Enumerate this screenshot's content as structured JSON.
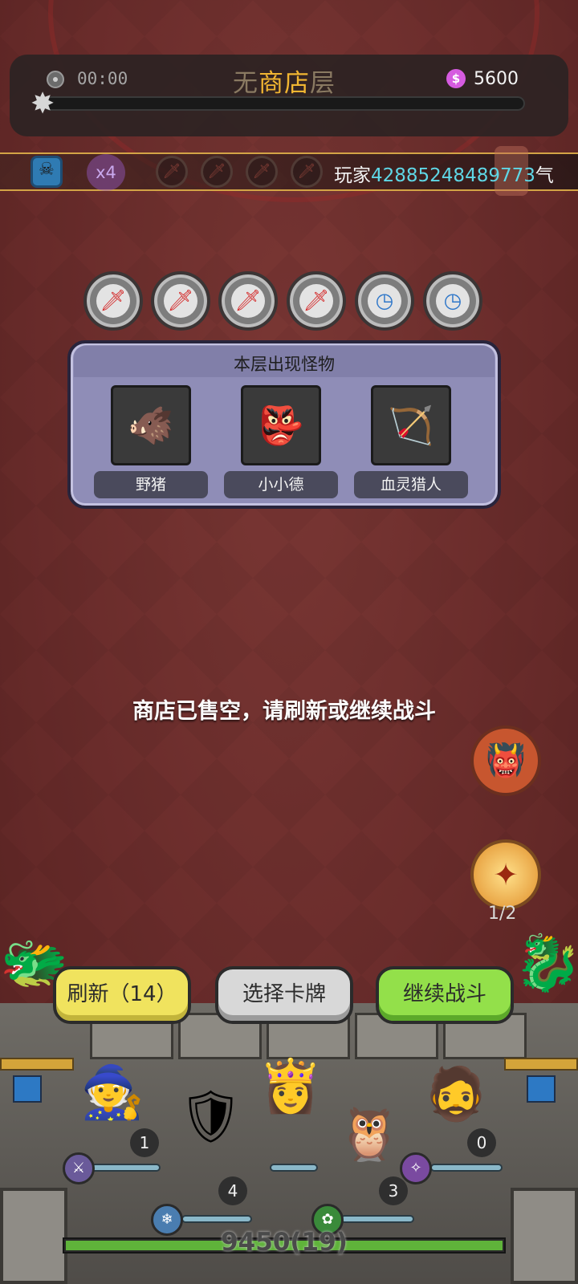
{
  "header": {
    "timer": "00:00",
    "title_prefix": "无",
    "title_highlight": "商店",
    "title_suffix": "层",
    "currency_icon": "gem-icon",
    "currency": "5600",
    "floor_progress": 0
  },
  "ticker": {
    "multiplier": "x4",
    "prefix": "玩家",
    "player_id": "42885248489773",
    "suffix": "气运"
  },
  "relics": [
    {
      "icon": "sword-icon",
      "glyph": "🗡",
      "tone": "red"
    },
    {
      "icon": "sword-icon",
      "glyph": "🗡",
      "tone": "red"
    },
    {
      "icon": "sword-icon",
      "glyph": "🗡",
      "tone": "red"
    },
    {
      "icon": "sword-icon",
      "glyph": "🗡",
      "tone": "red"
    },
    {
      "icon": "timer-icon",
      "glyph": "◷",
      "tone": "blue"
    },
    {
      "icon": "timer-icon",
      "glyph": "◷",
      "tone": "blue"
    }
  ],
  "monster_panel": {
    "title": "本层出现怪物",
    "monsters": [
      {
        "name": "野猪",
        "icon": "boar-icon",
        "glyph": "🐗"
      },
      {
        "name": "小小德",
        "icon": "goblin-icon",
        "glyph": "👺"
      },
      {
        "name": "血灵猎人",
        "icon": "hunter-icon",
        "glyph": "🏹"
      }
    ]
  },
  "message": "商店已售空，请刷新或继续战斗",
  "side": {
    "spell_count": "1/2"
  },
  "buttons": {
    "refresh": "刷新（14）",
    "select_cards": "选择卡牌",
    "continue_battle": "继续战斗"
  },
  "units": [
    {
      "name": "dark-mage",
      "glyph": "🧙",
      "level": "1"
    },
    {
      "name": "ice-knight",
      "glyph": "🛡",
      "level": "4"
    },
    {
      "name": "priestess",
      "glyph": "👸",
      "level": ""
    },
    {
      "name": "owl-druid",
      "glyph": "🦉",
      "level": "3"
    },
    {
      "name": "old-dwarf",
      "glyph": "🧔",
      "level": "0"
    }
  ],
  "bottom": {
    "score": "9450(19)"
  }
}
